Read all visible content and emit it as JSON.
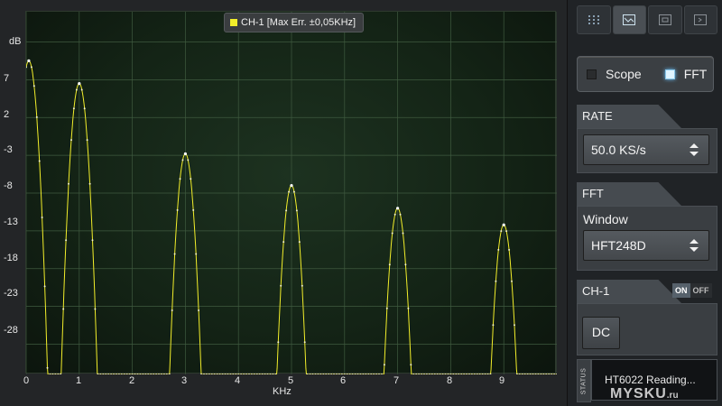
{
  "scope": {
    "y_unit_label": "dB",
    "x_unit_label": "KHz",
    "legend_label": "CH-1 [Max Err. ±0,05KHz]",
    "y_ticks": [
      "7",
      "2",
      "-3",
      "-8",
      "-13",
      "-18",
      "-23",
      "-28"
    ],
    "x_ticks": [
      "0",
      "1",
      "2",
      "3",
      "4",
      "5",
      "6",
      "7",
      "8",
      "9"
    ],
    "trace_color": "#f2ee2a"
  },
  "chart_data": {
    "type": "line",
    "xlabel": "KHz",
    "ylabel": "dB",
    "xlim": [
      0,
      10
    ],
    "ylim": [
      -37,
      11
    ],
    "grid": true,
    "series": [
      {
        "name": "CH-1",
        "peaks": [
          {
            "x": 0.05,
            "y": 4.5
          },
          {
            "x": 1.0,
            "y": 1.5
          },
          {
            "x": 3.0,
            "y": -7.8
          },
          {
            "x": 5.0,
            "y": -12.0
          },
          {
            "x": 7.0,
            "y": -15.0
          },
          {
            "x": 9.0,
            "y": -17.2
          }
        ],
        "floor_y": -37
      }
    ]
  },
  "panel": {
    "mode": {
      "scope_label": "Scope",
      "fft_label": "FFT",
      "scope_checked": false,
      "fft_checked": true
    },
    "rate": {
      "title": "RATE",
      "value": "50.0 KS/s"
    },
    "fft": {
      "title": "FFT",
      "window_label": "Window",
      "window_value": "HFT248D"
    },
    "channel": {
      "title": "CH-1",
      "on_label": "ON",
      "off_label": "OFF",
      "coupling_label": "DC"
    },
    "status": {
      "tab_label": "STATUS",
      "text": "HT6022 Reading..."
    },
    "watermark": {
      "main": "MYSKU",
      "suffix": ".ru"
    },
    "toolbar": [
      {
        "icon": "dots-grid-icon",
        "active": false
      },
      {
        "icon": "spectrum-view-icon",
        "active": true
      },
      {
        "icon": "window-view-icon",
        "active": false
      },
      {
        "icon": "export-view-icon",
        "active": false
      }
    ]
  },
  "colors": {
    "accent_on": "#dff4ff",
    "grid": "#3f5a3f",
    "plot_bg": "#152616"
  }
}
